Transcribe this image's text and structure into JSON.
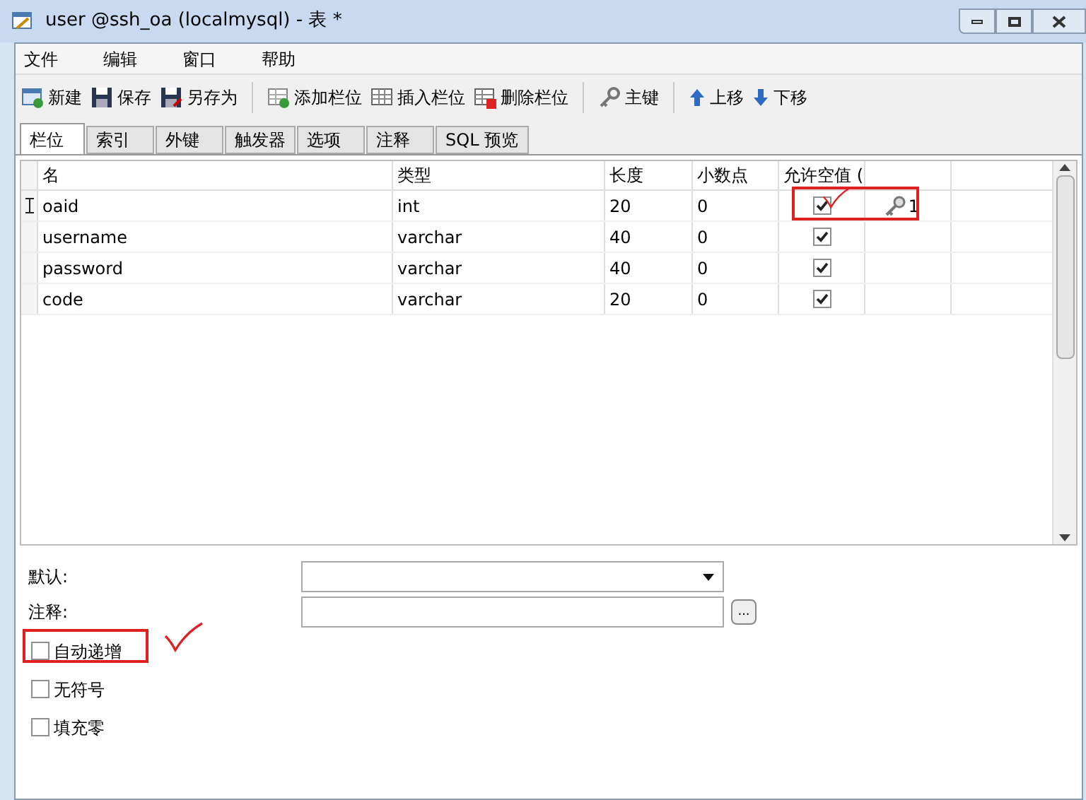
{
  "window": {
    "title": "user @ssh_oa (localmysql) - 表 *"
  },
  "menu": [
    "文件",
    "编辑",
    "窗口",
    "帮助"
  ],
  "toolbar": [
    {
      "kind": "new",
      "label": "新建"
    },
    {
      "kind": "save",
      "label": "保存"
    },
    {
      "kind": "saveas",
      "label": "另存为"
    },
    {
      "kind": "sep"
    },
    {
      "kind": "addcol",
      "label": "添加栏位"
    },
    {
      "kind": "inscol",
      "label": "插入栏位"
    },
    {
      "kind": "delcol",
      "label": "删除栏位"
    },
    {
      "kind": "sep"
    },
    {
      "kind": "key",
      "label": "主键"
    },
    {
      "kind": "sep"
    },
    {
      "kind": "up",
      "label": "上移"
    },
    {
      "kind": "down",
      "label": "下移"
    }
  ],
  "tabs": [
    {
      "label": "栏位",
      "selected": true
    },
    {
      "label": "索引",
      "selected": false
    },
    {
      "label": "外键",
      "selected": false
    },
    {
      "label": "触发器",
      "selected": false
    },
    {
      "label": "选项",
      "selected": false
    },
    {
      "label": "注释",
      "selected": false
    },
    {
      "label": "SQL 预览",
      "selected": false
    }
  ],
  "table": {
    "columns": [
      "名",
      "类型",
      "长度",
      "小数点",
      "允许空值 ("
    ],
    "rows": [
      {
        "current": true,
        "highlighted": true,
        "name": "oaid",
        "type": "int",
        "length": "20",
        "decimals": "0",
        "nullable": true,
        "primary_key": true,
        "key_order": "1"
      },
      {
        "current": false,
        "highlighted": false,
        "name": "username",
        "type": "varchar",
        "length": "40",
        "decimals": "0",
        "nullable": true,
        "primary_key": false
      },
      {
        "current": false,
        "highlighted": false,
        "name": "password",
        "type": "varchar",
        "length": "40",
        "decimals": "0",
        "nullable": true,
        "primary_key": false
      },
      {
        "current": false,
        "highlighted": false,
        "name": "code",
        "type": "varchar",
        "length": "20",
        "decimals": "0",
        "nullable": true,
        "primary_key": false
      }
    ]
  },
  "properties": {
    "default_label": "默认:",
    "comment_label": "注释:",
    "comment_button": "...",
    "options": [
      {
        "label": "自动递增",
        "checked": false,
        "highlighted": true
      },
      {
        "label": "无符号",
        "checked": false,
        "highlighted": false
      },
      {
        "label": "填充零",
        "checked": false,
        "highlighted": false
      }
    ]
  }
}
